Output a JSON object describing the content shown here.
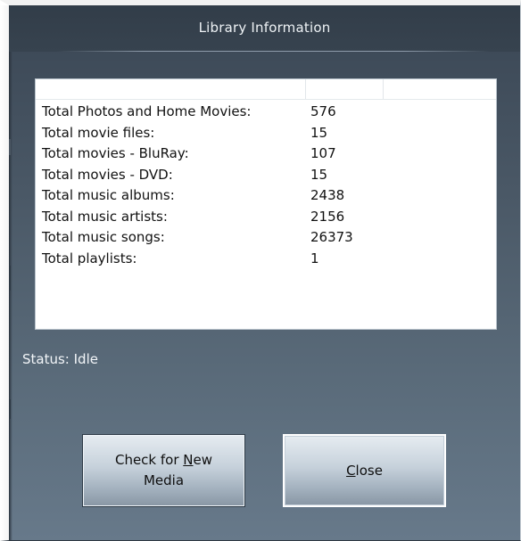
{
  "window": {
    "title": "Library Information"
  },
  "stats": [
    {
      "label": "Total Photos and Home Movies:",
      "value": "576"
    },
    {
      "label": "Total movie files:",
      "value": "15"
    },
    {
      "label": "Total movies - BluRay:",
      "value": "107"
    },
    {
      "label": "Total movies - DVD:",
      "value": "15"
    },
    {
      "label": "Total music albums:",
      "value": "2438"
    },
    {
      "label": "Total music artists:",
      "value": "2156"
    },
    {
      "label": "Total music songs:",
      "value": "26373"
    },
    {
      "label": "Total playlists:",
      "value": "1"
    }
  ],
  "status": {
    "text": "Status: Idle"
  },
  "buttons": {
    "check_pre": "Check for ",
    "check_mnemonic": "N",
    "check_post": "ew",
    "check_line2": "Media",
    "close_mnemonic": "C",
    "close_post": "lose"
  },
  "colors": {
    "background_top": "#3a4654",
    "background_bottom": "#67798a",
    "panel": "#ffffff"
  }
}
